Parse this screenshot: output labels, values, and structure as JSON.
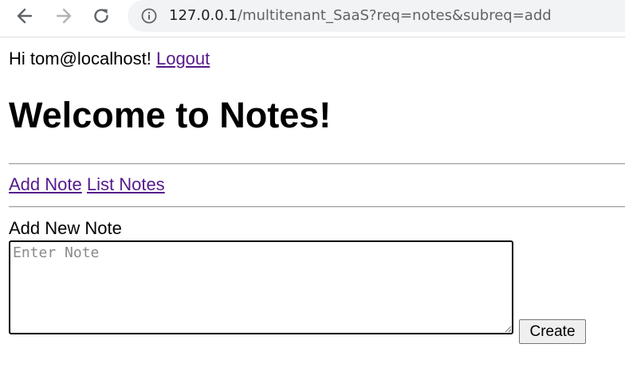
{
  "browser": {
    "url_host": "127.0.0.1",
    "url_path": "/multitenant_SaaS?req=notes&subreq=add"
  },
  "header": {
    "greeting": "Hi tom@localhost!",
    "logout_label": "Logout"
  },
  "page_title": "Welcome to Notes!",
  "nav": {
    "add_note_label": "Add Note",
    "list_notes_label": "List Notes"
  },
  "form": {
    "label": "Add New Note",
    "note_value": "",
    "note_placeholder": "Enter Note",
    "create_label": "Create"
  },
  "icons": {
    "back": "arrow-left-icon",
    "forward": "arrow-right-icon",
    "reload": "reload-icon",
    "info": "info-icon"
  }
}
